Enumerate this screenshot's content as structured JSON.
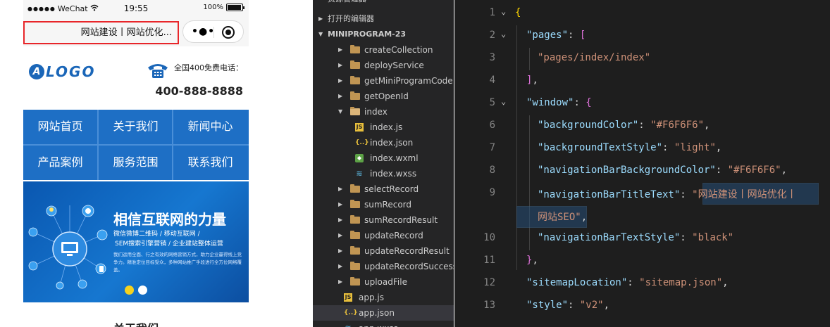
{
  "phone": {
    "status": {
      "carrier": "WeChat",
      "time": "19:55",
      "battery": "100%"
    },
    "nav_title": "网站建设丨网站优化...",
    "header": {
      "logo_text": "LOGO",
      "logo_mark": "A",
      "hotline_label": "全国400免费电话：",
      "hotline_number": "400-888-8888"
    },
    "menu": [
      "网站首页",
      "关于我们",
      "新闻中心",
      "产品案例",
      "服务范围",
      "联系我们"
    ],
    "banner": {
      "title": "相信互联网的力量",
      "sub1": "微信微博二维码 / 移动互联网 /",
      "sub2": "SEM搜索引擎营销 / 企业建站整体运营",
      "desc": "我们运用全面、行之有效的网络营销方式，助力企业赢得线上竞争力。精准定位目标受众，多种网站推广手段进行全方位网络覆盖。",
      "dot_colors": [
        "#f5d21f",
        "#ffffff"
      ]
    },
    "about_title": "关于我们"
  },
  "explorer": {
    "top_cut": "资源管理器",
    "open_editors": "打开的编辑器",
    "project": "MINIPROGRAM-23",
    "tree": [
      {
        "name": "createCollection",
        "type": "folder"
      },
      {
        "name": "deployService",
        "type": "folder"
      },
      {
        "name": "getMiniProgramCode",
        "type": "folder"
      },
      {
        "name": "getOpenId",
        "type": "folder"
      },
      {
        "name": "index",
        "type": "folder-open"
      },
      {
        "name": "index.js",
        "type": "js"
      },
      {
        "name": "index.json",
        "type": "json"
      },
      {
        "name": "index.wxml",
        "type": "wxml"
      },
      {
        "name": "index.wxss",
        "type": "wxss"
      },
      {
        "name": "selectRecord",
        "type": "folder"
      },
      {
        "name": "sumRecord",
        "type": "folder"
      },
      {
        "name": "sumRecordResult",
        "type": "folder"
      },
      {
        "name": "updateRecord",
        "type": "folder"
      },
      {
        "name": "updateRecordResult",
        "type": "folder"
      },
      {
        "name": "updateRecordSuccess",
        "type": "folder"
      },
      {
        "name": "uploadFile",
        "type": "folder"
      },
      {
        "name": "app.js",
        "type": "js"
      },
      {
        "name": "app.json",
        "type": "json"
      },
      {
        "name": "app.wxss",
        "type": "wxss"
      }
    ],
    "icon_labels": {
      "js": "JS",
      "json": "{..}",
      "wxml": "◆",
      "wxss": "≋"
    }
  },
  "editor": {
    "line_numbers": [
      "1",
      "2",
      "3",
      "4",
      "5",
      "6",
      "7",
      "8",
      "9",
      "",
      "10",
      "11",
      "12",
      "13"
    ],
    "code": {
      "l1": "{",
      "l2_key": "\"pages\"",
      "l2_rest": ": ",
      "l2_br": "[",
      "l3": "\"pages/index/index\"",
      "l4_br": "]",
      "l4_rest": ",",
      "l5_key": "\"window\"",
      "l5_rest": ": ",
      "l5_br": "{",
      "l6_key": "\"backgroundColor\"",
      "l6_val": "\"#F6F6F6\"",
      "l7_key": "\"backgroundTextStyle\"",
      "l7_val": "\"light\"",
      "l8_key": "\"navigationBarBackgroundColor\"",
      "l8_val": "\"#F6F6F6\"",
      "l9_key": "\"navigationBarTitleText\"",
      "l9_val_a": "\"",
      "l9_val_b": "网站建设丨网站优化丨",
      "l9_val_c": "网站SEO",
      "l9_val_d": "\"",
      "l10_key": "\"navigationBarTextStyle\"",
      "l10_val": "\"black\"",
      "l11_br": "}",
      "l11_rest": ",",
      "l12_key": "\"sitemapLocation\"",
      "l12_val": "\"sitemap.json\"",
      "l13_key": "\"style\"",
      "l13_val": "\"v2\"",
      "sep": ": ",
      "comma": ","
    }
  }
}
